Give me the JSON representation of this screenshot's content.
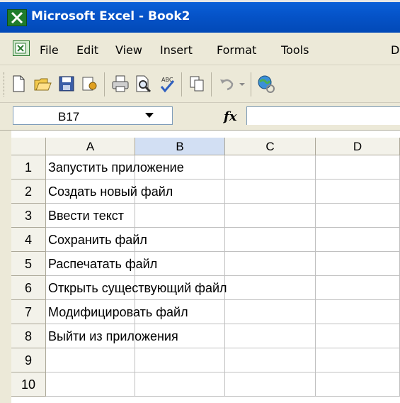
{
  "window": {
    "title": "Microsoft Excel - Book2"
  },
  "menu": {
    "items": [
      "File",
      "Edit",
      "View",
      "Insert",
      "Format",
      "Tools",
      "D"
    ]
  },
  "toolbar": {
    "icons": [
      "new-icon",
      "open-icon",
      "save-icon",
      "permission-icon",
      "print-icon",
      "print-preview-icon",
      "spelling-icon",
      "copy-icon",
      "undo-icon",
      "undo-dropdown-icon",
      "hyperlink-icon"
    ]
  },
  "formula_bar": {
    "name_box": "B17",
    "fx_label": "fx",
    "formula": ""
  },
  "sheet": {
    "columns": [
      "A",
      "B",
      "C",
      "D"
    ],
    "selected_column": "B",
    "rows": [
      {
        "num": "1",
        "a": "Запустить приложение"
      },
      {
        "num": "2",
        "a": "Создать новый файл"
      },
      {
        "num": "3",
        "a": "Ввести текст"
      },
      {
        "num": "4",
        "a": "Сохранить файл"
      },
      {
        "num": "5",
        "a": "Распечатать файл"
      },
      {
        "num": "6",
        "a": "Открыть существующий файл"
      },
      {
        "num": "7",
        "a": "Модифицировать файл"
      },
      {
        "num": "8",
        "a": "Выйти из приложения"
      },
      {
        "num": "9",
        "a": ""
      },
      {
        "num": "10",
        "a": ""
      }
    ]
  },
  "colors": {
    "titlebar": "#0553c8",
    "chrome": "#ece9d8",
    "selected_header": "#d2dff3"
  }
}
